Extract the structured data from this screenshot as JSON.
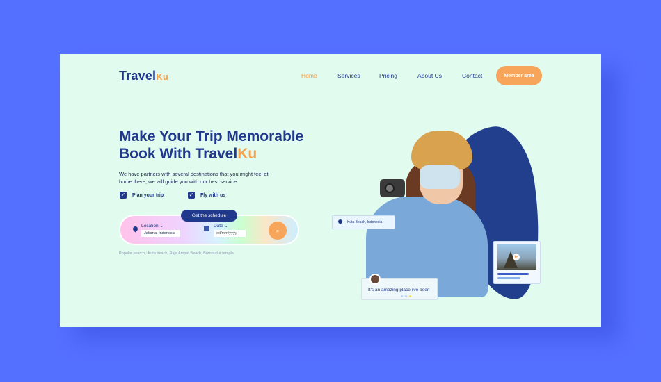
{
  "header": {
    "logo_main": "Travel",
    "logo_suffix": "Ku",
    "nav": [
      "Home",
      "Services",
      "Pricing",
      "About Us",
      "Contact"
    ],
    "member_button": "Member area"
  },
  "hero": {
    "title_line1": "Make Your Trip Memorable",
    "title_line2_main": "Book With Travel",
    "title_line2_suffix": "Ku",
    "description": "We have partners with several destinations that you might feel at home there, we will guide you with our best service.",
    "checks": [
      "Plan your trip",
      "Fly with us"
    ]
  },
  "search": {
    "schedule_button": "Get the schedule",
    "location_label": "Location",
    "location_value": "Jakarta, Indonesia",
    "date_label": "Date",
    "date_value": "dd/mm/yyyy",
    "popular": "Popular search : Kuta beach, Raja Ampat Beach, Borobudur temple"
  },
  "cards": {
    "location_tag": "Kuta Beach, Indonesia",
    "comment": "It's an amazing place i've been"
  },
  "colors": {
    "primary": "#20398c",
    "accent": "#f7a55b",
    "background": "#5470ff",
    "page": "#e2fbef"
  },
  "icons": [
    "location-pin-icon",
    "calendar-icon",
    "search-icon",
    "check-icon",
    "play-icon",
    "chevron-down-icon"
  ]
}
